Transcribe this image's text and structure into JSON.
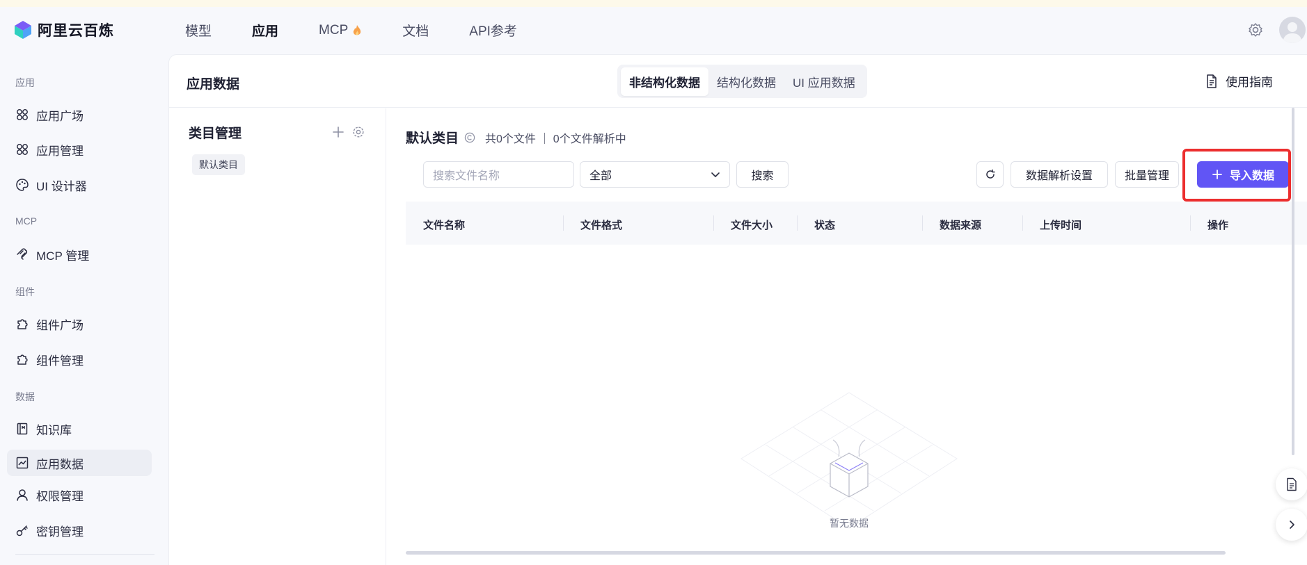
{
  "header": {
    "logo_text": "阿里云百炼",
    "nav": [
      {
        "label": "模型"
      },
      {
        "label": "应用"
      },
      {
        "label": "MCP"
      },
      {
        "label": "文档"
      },
      {
        "label": "API参考"
      }
    ]
  },
  "sidebar": {
    "groups": [
      "应用",
      "MCP",
      "组件",
      "数据"
    ],
    "items": [
      {
        "label": "应用广场"
      },
      {
        "label": "应用管理"
      },
      {
        "label": "UI 设计器"
      },
      {
        "label": "MCP 管理"
      },
      {
        "label": "组件广场"
      },
      {
        "label": "组件管理"
      },
      {
        "label": "知识库"
      },
      {
        "label": "应用数据"
      },
      {
        "label": "权限管理"
      },
      {
        "label": "密钥管理"
      }
    ]
  },
  "page": {
    "title": "应用数据",
    "tabs": [
      {
        "label": "非结构化数据"
      },
      {
        "label": "结构化数据"
      },
      {
        "label": "UI 应用数据"
      }
    ],
    "guide_label": "使用指南"
  },
  "categories": {
    "title": "类目管理",
    "items": [
      {
        "label": "默认类目"
      }
    ]
  },
  "content": {
    "title": "默认类目",
    "stats": "共0个文件 ｜ 0个文件解析中",
    "search_placeholder": "搜索文件名称",
    "filter_value": "全部",
    "search_button": "搜索",
    "parse_settings_button": "数据解析设置",
    "batch_button": "批量管理",
    "import_button": "导入数据",
    "columns": [
      "文件名称",
      "文件格式",
      "文件大小",
      "状态",
      "数据来源",
      "上传时间",
      "操作"
    ],
    "empty_text": "暂无数据"
  },
  "colors": {
    "primary": "#6155f5",
    "highlight": "#ec2e2e"
  }
}
